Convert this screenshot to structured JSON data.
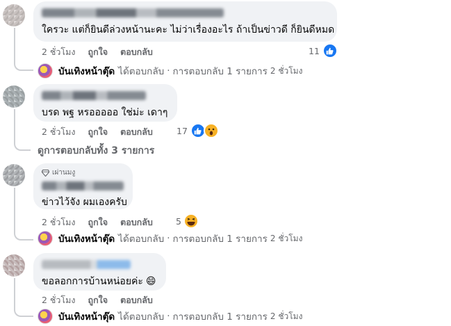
{
  "comments": [
    {
      "text": "ใครวะ แต่ก็ยินดีล่วงหน้านะคะ ไม่ว่าเรื่องอะไร ถ้าเป็นข่าวดี ก็ยินดีหมด",
      "time": "2 ชั่วโมง",
      "like_label": "ถูกใจ",
      "reply_label": "ตอบกลับ",
      "reaction_count": "11",
      "reactions": [
        "like"
      ]
    },
    {
      "text": "บรด พฐ หรอออออ ใช่ม่ะ เดาๆ",
      "time": "2 ชั่วโมง",
      "like_label": "ถูกใจ",
      "reply_label": "ตอบกลับ",
      "reaction_count": "17",
      "reactions": [
        "like",
        "wow"
      ]
    },
    {
      "badge": "เผ่านมงู",
      "text": "ข่าวไว้จัง ผมเองครับ",
      "time": "2 ชั่วโมง",
      "like_label": "ถูกใจ",
      "reply_label": "ตอบกลับ",
      "reaction_count": "5",
      "reactions": [
        "haha"
      ]
    },
    {
      "text": "ขอลอกการบ้านหน่อยค่ะ",
      "emoji": "😄",
      "time": "2 ชั่วโมง",
      "like_label": "ถูกใจ",
      "reply_label": "ตอบกลับ"
    }
  ],
  "replies": {
    "page_name": "บันเทิงหน้าตุ๊ด",
    "replied": "ได้ตอบกลับ",
    "sep": "·",
    "count_label": "การตอบกลับ 1 รายการ",
    "time": "2 ชั่วโมง"
  },
  "view_all": "ดูการตอบกลับทั้ง 3 รายการ",
  "colors": {
    "bubble": "#f0f2f5",
    "meta": "#65676b",
    "like_blue": "#1877f2",
    "emoji_yellow": "#f7b125"
  }
}
